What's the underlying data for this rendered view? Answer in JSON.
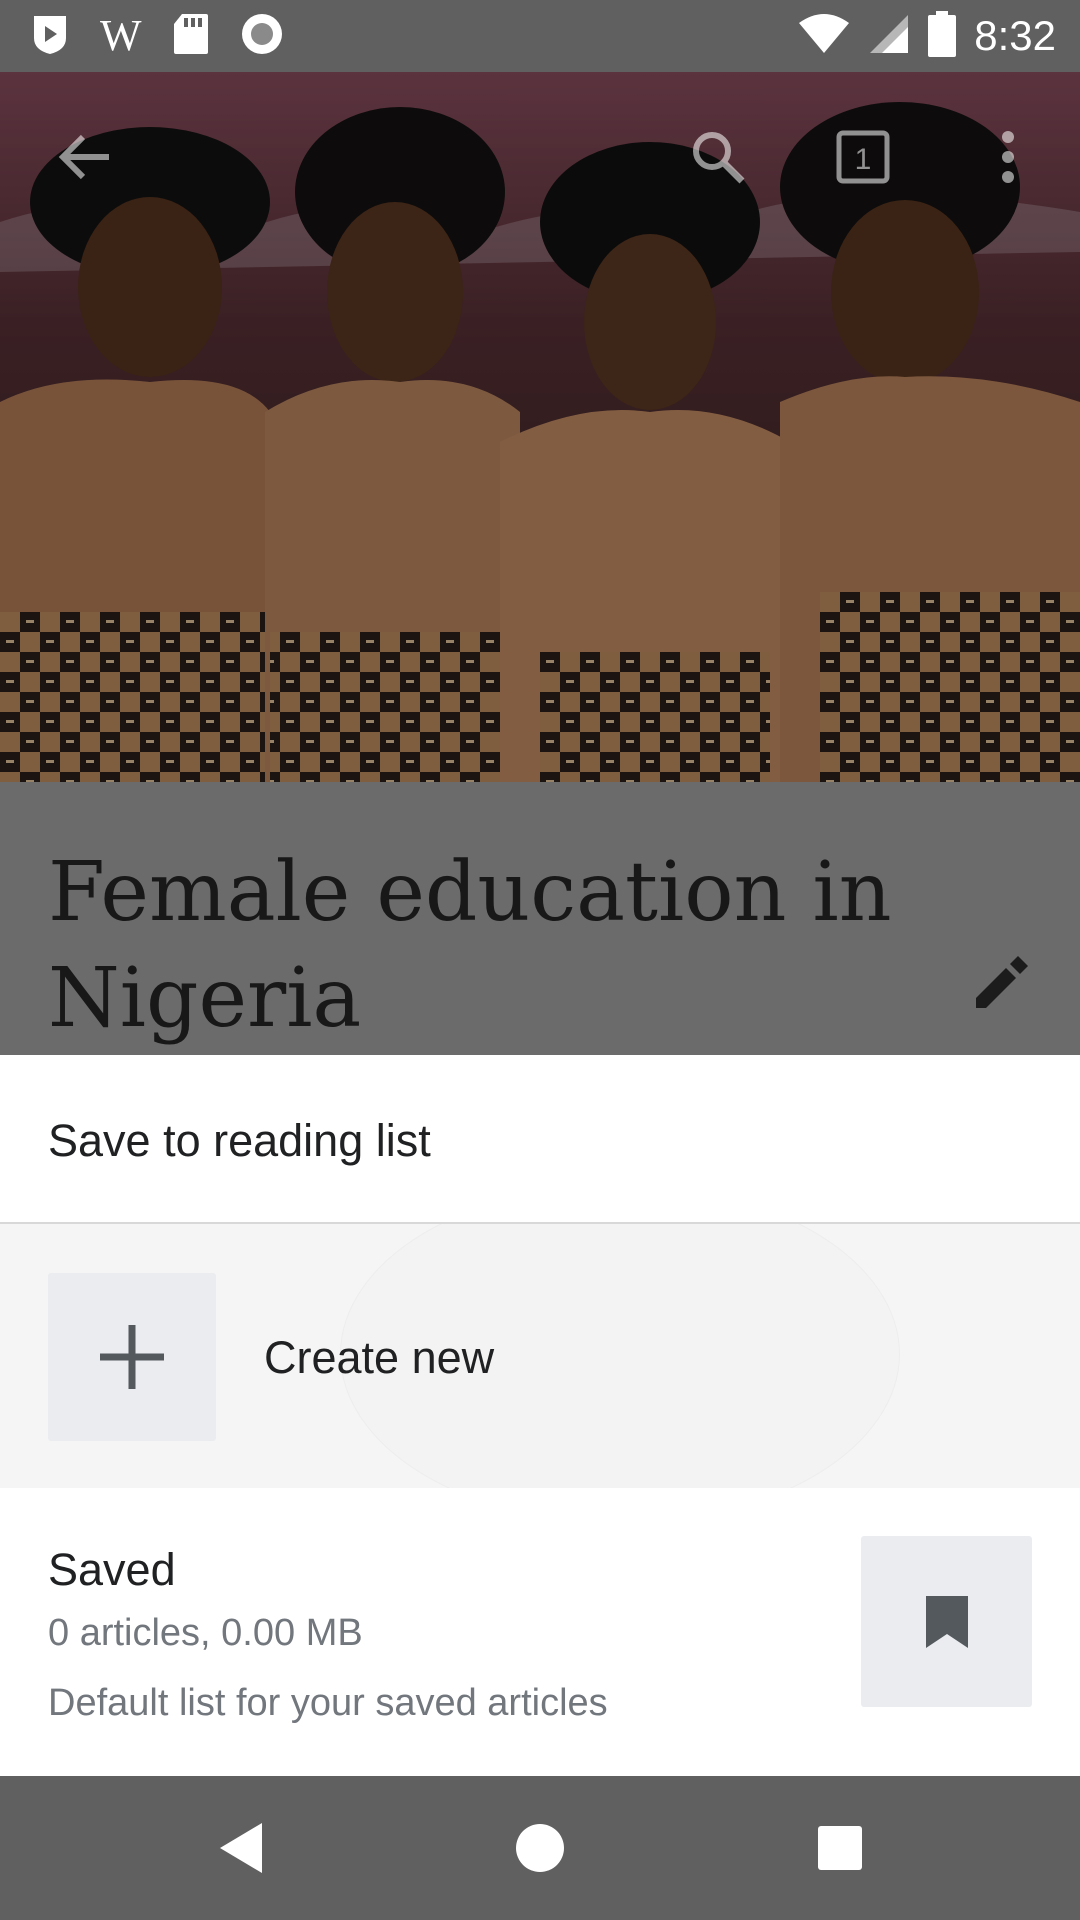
{
  "status_bar": {
    "time": "8:32",
    "left_icons": [
      "play-store-icon",
      "wikipedia-w-icon",
      "sd-card-icon",
      "record-icon"
    ],
    "wikipedia_letter": "W",
    "right_icons": [
      "wifi-icon",
      "cell-signal-icon",
      "battery-icon"
    ]
  },
  "toolbar": {
    "icons": [
      "back-arrow-icon",
      "search-icon",
      "tabs-icon",
      "more-vert-icon"
    ],
    "tab_count": "1"
  },
  "article": {
    "title_line1": "Female education in",
    "title_line2": "Nigeria",
    "edit_icon": "pencil-icon"
  },
  "sheet": {
    "title": "Save to reading list",
    "create_new_label": "Create new",
    "create_icon": "plus-icon",
    "lists": [
      {
        "name": "Saved",
        "stats": "0 articles, 0.00 MB",
        "description": "Default list for your saved articles",
        "icon": "bookmark-icon"
      }
    ]
  },
  "nav_bar": {
    "icons": [
      "nav-back-icon",
      "nav-home-icon",
      "nav-recents-icon"
    ]
  },
  "colors": {
    "system_bar": "#606060",
    "text_primary": "#202122",
    "text_secondary": "#72777d",
    "thumb_bg": "#eaecf0",
    "create_row_bg": "#f5f5f5"
  }
}
